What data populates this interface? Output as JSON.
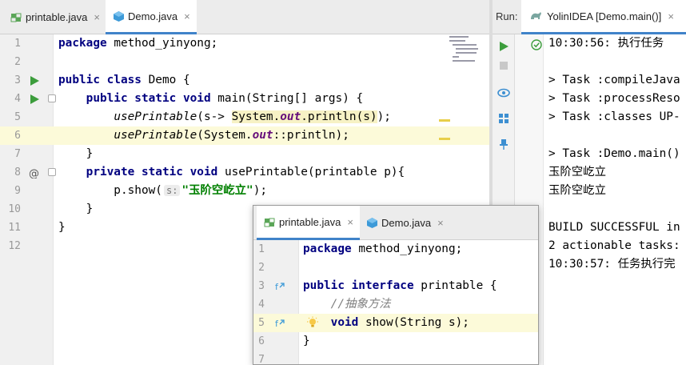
{
  "editor_tabs": [
    {
      "label": "printable.java",
      "close": "×",
      "active": false
    },
    {
      "label": "Demo.java",
      "close": "×",
      "active": true
    }
  ],
  "editor_lines": [
    {
      "num": "1",
      "tokens": [
        {
          "t": "package",
          "c": "kw"
        },
        {
          "t": " method_yinyong;",
          "c": ""
        }
      ]
    },
    {
      "num": "2",
      "tokens": []
    },
    {
      "num": "3",
      "tokens": [
        {
          "t": "public class",
          "c": "kw"
        },
        {
          "t": " Demo {",
          "c": ""
        }
      ]
    },
    {
      "num": "4",
      "tokens": [
        {
          "t": "    public static void",
          "c": "kw"
        },
        {
          "t": " main(String[] args) {",
          "c": ""
        }
      ]
    },
    {
      "num": "5",
      "tokens": [
        {
          "t": "        ",
          "c": ""
        },
        {
          "t": "usePrintable",
          "c": "it"
        },
        {
          "t": "(s-> ",
          "c": ""
        },
        {
          "t": "System.",
          "c": "warn-bg"
        },
        {
          "t": "out",
          "c": "fld warn-bg"
        },
        {
          "t": ".println(s)",
          "c": "warn-bg"
        },
        {
          "t": ");",
          "c": ""
        }
      ]
    },
    {
      "num": "6",
      "tokens": [
        {
          "t": "        ",
          "c": ""
        },
        {
          "t": "usePrintable",
          "c": "it"
        },
        {
          "t": "(System.",
          "c": ""
        },
        {
          "t": "out",
          "c": "fld"
        },
        {
          "t": "::println);",
          "c": ""
        }
      ]
    },
    {
      "num": "7",
      "tokens": [
        {
          "t": "    }",
          "c": ""
        }
      ]
    },
    {
      "num": "8",
      "tokens": [
        {
          "t": "    private static void",
          "c": "kw"
        },
        {
          "t": " usePrintable(printable p){",
          "c": ""
        }
      ]
    },
    {
      "num": "9",
      "tokens": [
        {
          "t": "        p.show(",
          "c": ""
        },
        {
          "t": "s:",
          "c": "hint"
        },
        {
          "t": "\"玉阶空屹立\"",
          "c": "str"
        },
        {
          "t": ");",
          "c": ""
        }
      ]
    },
    {
      "num": "10",
      "tokens": [
        {
          "t": "    }",
          "c": ""
        }
      ]
    },
    {
      "num": "11",
      "tokens": [
        {
          "t": "}",
          "c": ""
        }
      ]
    },
    {
      "num": "12",
      "tokens": []
    }
  ],
  "run_panel": {
    "label": "Run:",
    "tab_label": "YolinIDEA [Demo.main()]",
    "close": "×"
  },
  "console_lines": [
    "10:30:56: 执行任务",
    "",
    "> Task :compileJava",
    "> Task :processReso",
    "> Task :classes UP-",
    "",
    "> Task :Demo.main()",
    "玉阶空屹立",
    "玉阶空屹立",
    "",
    "BUILD SUCCESSFUL in",
    "2 actionable tasks:",
    "10:30:57: 任务执行完"
  ],
  "popup_tabs": [
    {
      "label": "printable.java",
      "close": "×",
      "active": true
    },
    {
      "label": "Demo.java",
      "close": "×",
      "active": false
    }
  ],
  "popup_lines": [
    {
      "num": "1",
      "tokens": [
        {
          "t": "package",
          "c": "kw"
        },
        {
          "t": " method_yinyong;",
          "c": ""
        }
      ]
    },
    {
      "num": "2",
      "tokens": []
    },
    {
      "num": "3",
      "tokens": [
        {
          "t": "public interface",
          "c": "kw"
        },
        {
          "t": " printable {",
          "c": ""
        }
      ]
    },
    {
      "num": "4",
      "tokens": [
        {
          "t": "    //抽象方法",
          "c": "cmt"
        }
      ]
    },
    {
      "num": "5",
      "tokens": [
        {
          "t": "    void",
          "c": "kw"
        },
        {
          "t": " show(String s);",
          "c": ""
        }
      ]
    },
    {
      "num": "6",
      "tokens": [
        {
          "t": "}",
          "c": ""
        }
      ]
    },
    {
      "num": "7",
      "tokens": []
    }
  ],
  "colors": {
    "accent": "#4083c9",
    "keyword": "#000080",
    "string": "#008000",
    "run_green": "#3c9d3c"
  }
}
